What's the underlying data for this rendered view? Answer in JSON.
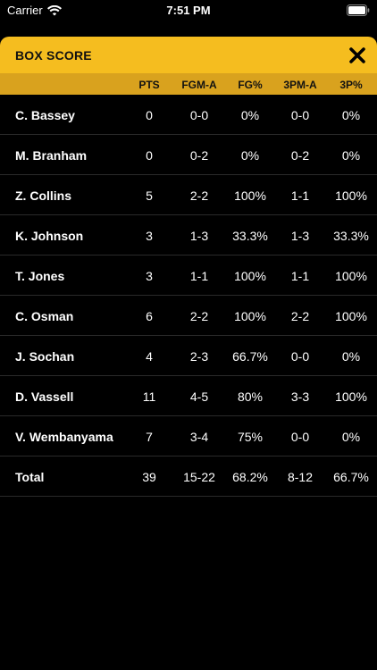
{
  "status": {
    "carrier": "Carrier",
    "time": "7:51 PM"
  },
  "header": {
    "title": "BOX SCORE"
  },
  "columns": [
    "PTS",
    "FGM-A",
    "FG%",
    "3PM-A",
    "3P%"
  ],
  "rows": [
    {
      "name": "C. Bassey",
      "pts": "0",
      "fgm": "0-0",
      "fgp": "0%",
      "tpm": "0-0",
      "tpp": "0%"
    },
    {
      "name": "M. Branham",
      "pts": "0",
      "fgm": "0-2",
      "fgp": "0%",
      "tpm": "0-2",
      "tpp": "0%"
    },
    {
      "name": "Z. Collins",
      "pts": "5",
      "fgm": "2-2",
      "fgp": "100%",
      "tpm": "1-1",
      "tpp": "100%"
    },
    {
      "name": "K. Johnson",
      "pts": "3",
      "fgm": "1-3",
      "fgp": "33.3%",
      "tpm": "1-3",
      "tpp": "33.3%"
    },
    {
      "name": "T. Jones",
      "pts": "3",
      "fgm": "1-1",
      "fgp": "100%",
      "tpm": "1-1",
      "tpp": "100%"
    },
    {
      "name": "C. Osman",
      "pts": "6",
      "fgm": "2-2",
      "fgp": "100%",
      "tpm": "2-2",
      "tpp": "100%"
    },
    {
      "name": "J. Sochan",
      "pts": "4",
      "fgm": "2-3",
      "fgp": "66.7%",
      "tpm": "0-0",
      "tpp": "0%"
    },
    {
      "name": "D. Vassell",
      "pts": "11",
      "fgm": "4-5",
      "fgp": "80%",
      "tpm": "3-3",
      "tpp": "100%"
    },
    {
      "name": "V. Wembanyama",
      "pts": "7",
      "fgm": "3-4",
      "fgp": "75%",
      "tpm": "0-0",
      "tpp": "0%"
    },
    {
      "name": "Total",
      "pts": "39",
      "fgm": "15-22",
      "fgp": "68.2%",
      "tpm": "8-12",
      "tpp": "66.7%"
    }
  ],
  "colors": {
    "header": "#f5bd1f",
    "column_header": "#d9a21e",
    "background": "#000000"
  }
}
